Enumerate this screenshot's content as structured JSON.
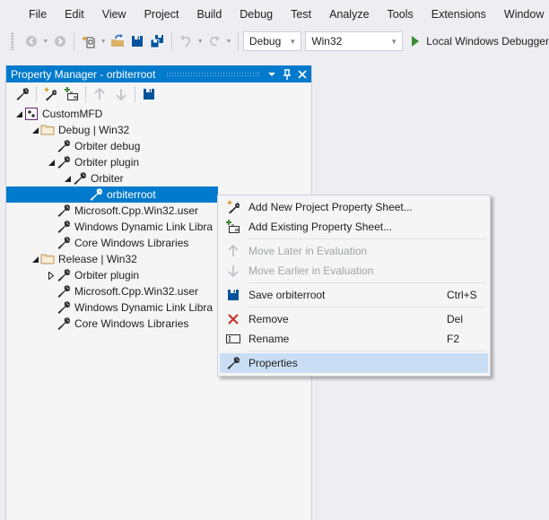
{
  "menubar": {
    "logo": "visual-studio-logo",
    "items": [
      "File",
      "Edit",
      "View",
      "Project",
      "Build",
      "Debug",
      "Test",
      "Analyze",
      "Tools",
      "Extensions",
      "Window"
    ]
  },
  "toolbar": {
    "icons": [
      "back-icon",
      "forward-icon",
      "new-project-icon",
      "open-file-icon",
      "save-icon",
      "save-all-icon",
      "undo-icon",
      "redo-icon"
    ],
    "configuration": "Debug",
    "platform": "Win32",
    "run_label": "Local Windows Debugger"
  },
  "panel": {
    "title": "Property Manager - orbiterroot",
    "title_buttons": [
      "window-position-dropdown",
      "auto-hide-pin",
      "close"
    ],
    "toolbar_icons": [
      "properties-icon",
      "add-new-property-sheet-icon",
      "add-existing-property-sheet-icon",
      "move-up-icon",
      "move-down-icon",
      "save-icon"
    ],
    "tree": [
      {
        "label": "CustomMFD",
        "level": 0,
        "expander": "expanded",
        "icon": "project-icon"
      },
      {
        "label": "Debug | Win32",
        "level": 1,
        "expander": "expanded",
        "icon": "folder-icon"
      },
      {
        "label": "Orbiter debug",
        "level": 2,
        "expander": "none",
        "icon": "wrench-icon"
      },
      {
        "label": "Orbiter plugin",
        "level": 2,
        "expander": "expanded",
        "icon": "wrench-icon"
      },
      {
        "label": "Orbiter",
        "level": 3,
        "expander": "expanded",
        "icon": "wrench-icon"
      },
      {
        "label": "orbiterroot",
        "level": 4,
        "expander": "none",
        "icon": "wrench-icon",
        "selected": true
      },
      {
        "label": "Microsoft.Cpp.Win32.user",
        "level": 2,
        "expander": "none",
        "icon": "wrench-icon"
      },
      {
        "label": "Windows Dynamic Link Libra",
        "level": 2,
        "expander": "none",
        "icon": "wrench-icon"
      },
      {
        "label": "Core Windows Libraries",
        "level": 2,
        "expander": "none",
        "icon": "wrench-icon"
      },
      {
        "label": "Release | Win32",
        "level": 1,
        "expander": "expanded",
        "icon": "folder-icon"
      },
      {
        "label": "Orbiter plugin",
        "level": 2,
        "expander": "collapsed",
        "icon": "wrench-icon"
      },
      {
        "label": "Microsoft.Cpp.Win32.user",
        "level": 2,
        "expander": "none",
        "icon": "wrench-icon"
      },
      {
        "label": "Windows Dynamic Link Libra",
        "level": 2,
        "expander": "none",
        "icon": "wrench-icon"
      },
      {
        "label": "Core Windows Libraries",
        "level": 2,
        "expander": "none",
        "icon": "wrench-icon"
      }
    ]
  },
  "context_menu": {
    "items": [
      {
        "label": "Add New Project Property Sheet...",
        "shortcut": "",
        "icon": "add-new-property-sheet-icon",
        "disabled": false
      },
      {
        "label": "Add Existing Property Sheet...",
        "shortcut": "",
        "icon": "add-existing-property-sheet-icon",
        "disabled": false
      },
      {
        "separator": true
      },
      {
        "label": "Move Later in Evaluation",
        "shortcut": "",
        "icon": "arrow-up-icon",
        "disabled": true
      },
      {
        "label": "Move Earlier in Evaluation",
        "shortcut": "",
        "icon": "arrow-down-icon",
        "disabled": true
      },
      {
        "separator": true
      },
      {
        "label": "Save orbiterroot",
        "shortcut": "Ctrl+S",
        "icon": "save-icon",
        "disabled": false
      },
      {
        "separator": true
      },
      {
        "label": "Remove",
        "shortcut": "Del",
        "icon": "remove-x-icon",
        "disabled": false
      },
      {
        "label": "Rename",
        "shortcut": "F2",
        "icon": "rename-icon",
        "disabled": false
      },
      {
        "separator": true
      },
      {
        "label": "Properties",
        "shortcut": "",
        "icon": "wrench-icon",
        "disabled": false,
        "hover": true
      }
    ]
  },
  "colors": {
    "accent": "#007acc",
    "menu_hover": "#c9def5",
    "run_green": "#388a34",
    "remove_red": "#c5352a",
    "save_blue": "#00539c",
    "vs_purple": "#865fc5"
  }
}
